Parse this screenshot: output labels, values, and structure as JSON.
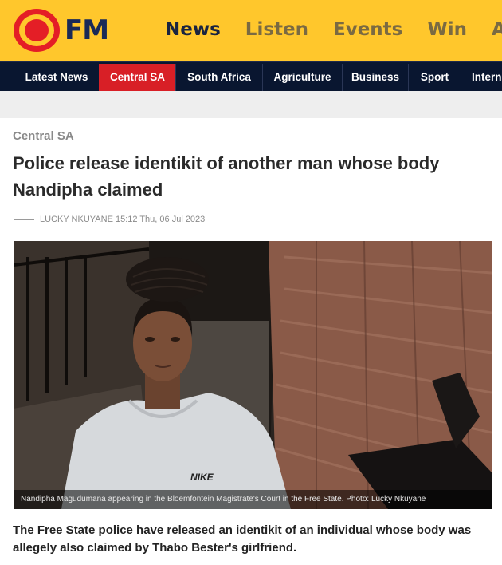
{
  "brand": {
    "logo_text": "FM",
    "colors": {
      "yellow": "#ffc72c",
      "red": "#e41e26",
      "navy": "#091630"
    }
  },
  "main_nav": [
    {
      "label": "News",
      "active": true
    },
    {
      "label": "Listen"
    },
    {
      "label": "Events"
    },
    {
      "label": "Win"
    },
    {
      "label": "Adv"
    }
  ],
  "categories": [
    {
      "label": "Latest News"
    },
    {
      "label": "Central SA",
      "active": true
    },
    {
      "label": "South Africa"
    },
    {
      "label": "Agriculture"
    },
    {
      "label": "Business"
    },
    {
      "label": "Sport"
    },
    {
      "label": "Intern"
    }
  ],
  "article": {
    "category": "Central SA",
    "headline": "Police release identikit of another man whose body Nandipha claimed",
    "byline": "LUCKY NKUYANE 15:12 Thu, 06 Jul 2023",
    "image_caption": "Nandipha Magudumana appearing in the Bloemfontein Magistrate's Court in the Free State. Photo: Lucky Nkuyane",
    "lead": "The Free State police have released an identikit of an individual whose body was allegely also claimed by Thabo Bester's girlfriend."
  }
}
